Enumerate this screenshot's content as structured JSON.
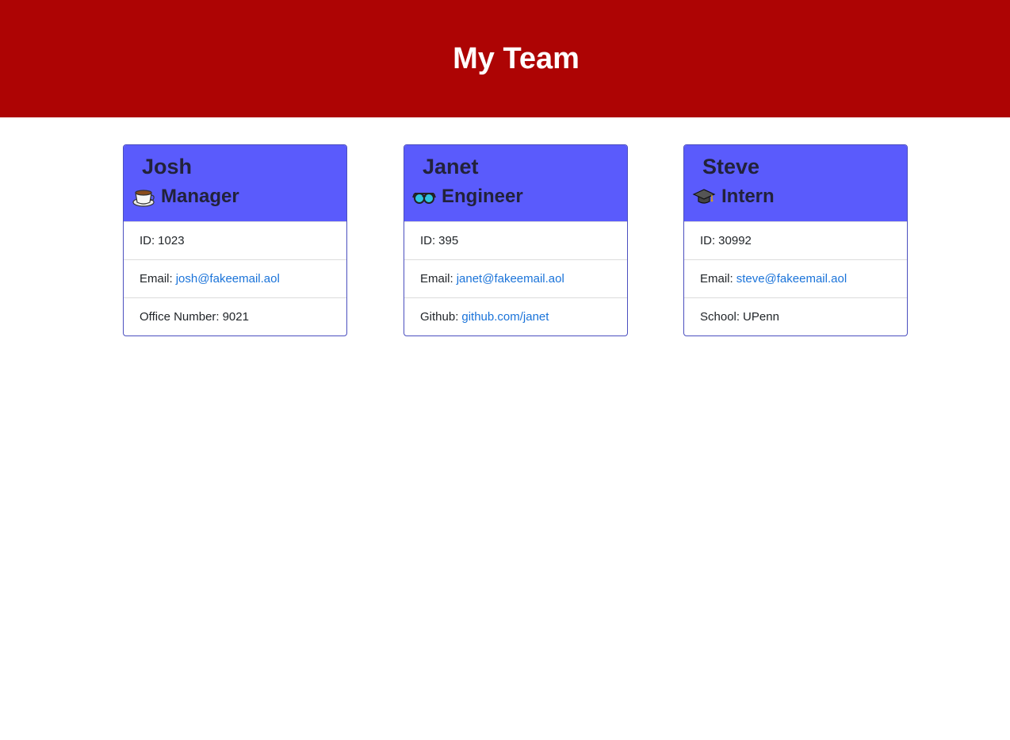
{
  "header": {
    "title": "My Team"
  },
  "cards": [
    {
      "name": "Josh",
      "role": "Manager",
      "role_icon": "coffee-cup-icon",
      "id_label": "ID:",
      "id_value": "1023",
      "email_label": "Email:",
      "email_value": "josh@fakeemail.aol",
      "extra_label": "Office Number:",
      "extra_value": "9021"
    },
    {
      "name": "Janet",
      "role": "Engineer",
      "role_icon": "glasses-icon",
      "id_label": "ID:",
      "id_value": "395",
      "email_label": "Email:",
      "email_value": "janet@fakeemail.aol",
      "extra_label": "Github:",
      "extra_value": "github.com/janet"
    },
    {
      "name": "Steve",
      "role": "Intern",
      "role_icon": "graduation-cap-icon",
      "id_label": "ID:",
      "id_value": "30992",
      "email_label": "Email:",
      "email_value": "steve@fakeemail.aol",
      "extra_label": "School:",
      "extra_value": "UPenn"
    }
  ],
  "colors": {
    "header_bg": "#ad0404",
    "card_header_bg": "#5a5bfc",
    "link": "#1a73d9"
  }
}
